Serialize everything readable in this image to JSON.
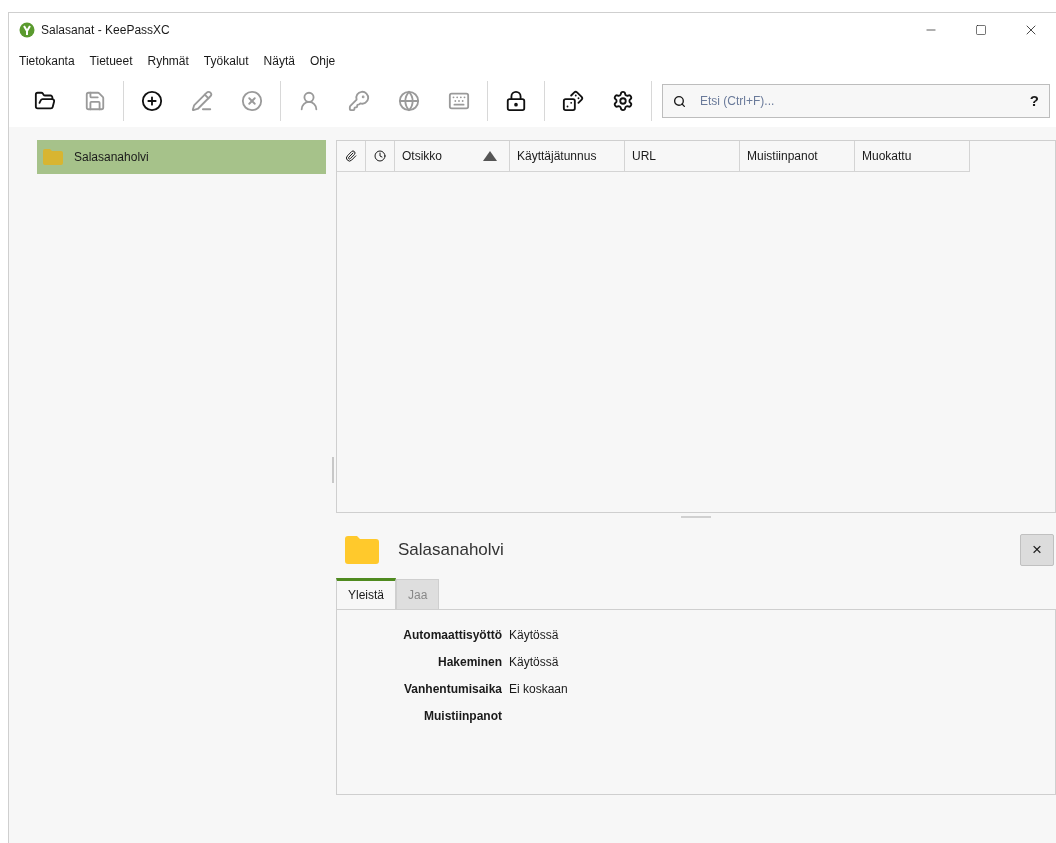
{
  "window": {
    "title": "Salasanat - KeePassXC"
  },
  "menu": [
    "Tietokanta",
    "Tietueet",
    "Ryhmät",
    "Työkalut",
    "Näytä",
    "Ohje"
  ],
  "toolbar": {
    "groups": [
      [
        {
          "disabled": false
        },
        {
          "disabled": true
        }
      ],
      [
        {
          "disabled": false
        },
        {
          "disabled": true
        },
        {
          "disabled": true
        }
      ],
      [
        {
          "disabled": true
        },
        {
          "disabled": true
        },
        {
          "disabled": true
        },
        {
          "disabled": true
        }
      ],
      [
        {
          "disabled": false
        }
      ],
      [
        {
          "disabled": false
        },
        {
          "disabled": false
        }
      ]
    ]
  },
  "search": {
    "placeholder": "Etsi (Ctrl+F)...",
    "help": "?"
  },
  "groups_tree": [
    {
      "name": "Salasanaholvi",
      "selected": true
    }
  ],
  "table": {
    "columns": [
      {
        "kind": "icon"
      },
      {
        "kind": "icon"
      },
      {
        "kind": "text",
        "label": "Otsikko",
        "sorted": true
      },
      {
        "kind": "text",
        "label": "Käyttäjätunnus",
        "sorted": false
      },
      {
        "kind": "text",
        "label": "URL",
        "sorted": false
      },
      {
        "kind": "text",
        "label": "Muistiinpanot",
        "sorted": false
      },
      {
        "kind": "text",
        "label": "Muokattu",
        "sorted": false
      }
    ]
  },
  "details": {
    "title": "Salasanaholvi",
    "close": "×",
    "tabs": [
      {
        "label": "Yleistä",
        "selected": true
      },
      {
        "label": "Jaa",
        "selected": false
      }
    ],
    "fields": [
      {
        "label": "Automaattisyöttö",
        "value": "Käytössä"
      },
      {
        "label": "Hakeminen",
        "value": "Käytössä"
      },
      {
        "label": "Vanhentumisaika",
        "value": "Ei koskaan"
      },
      {
        "label": "Muistiinpanot"
      }
    ]
  }
}
